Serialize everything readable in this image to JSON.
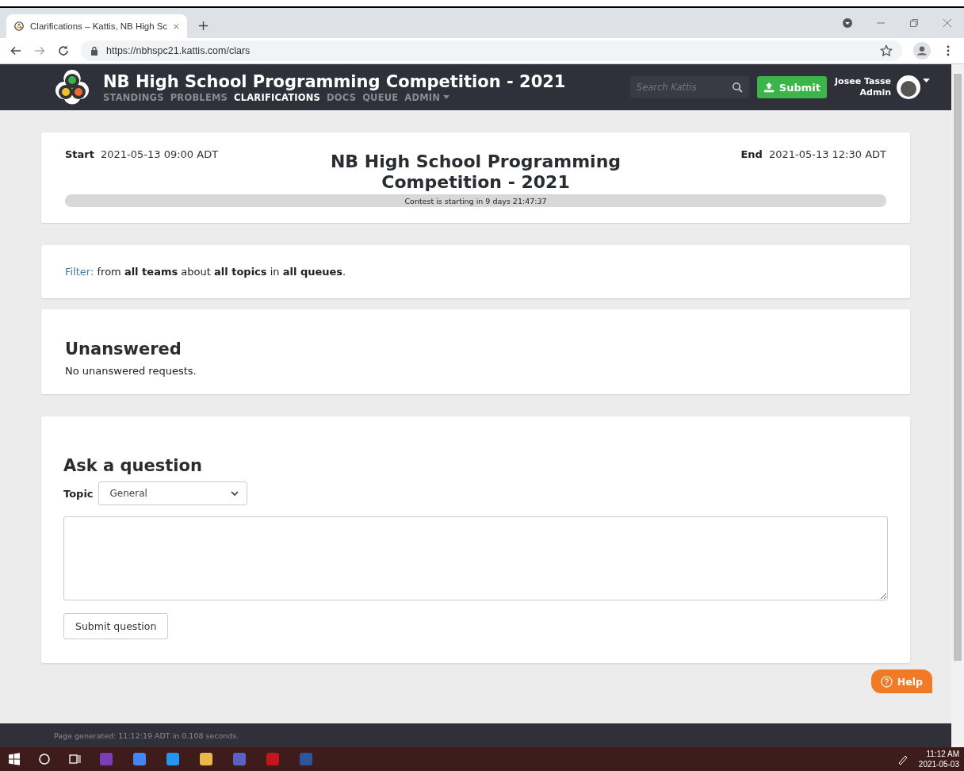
{
  "browser": {
    "tabs": [
      {
        "title": "Clarifications – Kattis, NB High Sc",
        "selected": true
      }
    ],
    "url": "https://nbhspc21.kattis.com/clars"
  },
  "site_header": {
    "title": "NB High School Programming Competition - 2021",
    "nav": [
      {
        "label": "STANDINGS",
        "selected": false
      },
      {
        "label": "PROBLEMS",
        "selected": false
      },
      {
        "label": "CLARIFICATIONS",
        "selected": true
      },
      {
        "label": "DOCS",
        "selected": false
      },
      {
        "label": "QUEUE",
        "selected": false
      },
      {
        "label": "ADMIN",
        "selected": false
      }
    ],
    "search": {
      "placeholder": "Search Kattis"
    },
    "submit_button": "Submit",
    "user": {
      "name": "Josee Tasse",
      "role": "Admin"
    }
  },
  "contest": {
    "start_label": "Start",
    "start": "2021-05-13 09:00 ADT",
    "title": "NB High School Programming Competition - 2021",
    "end_label": "End",
    "end": "2021-05-13 12:30 ADT",
    "progress": {
      "level": 0,
      "text": "Contest is starting in 9 days 21:47:37"
    }
  },
  "filter": {
    "link": "Filter:",
    "text": "from **all teams** about **all topics** in **all queues**."
  },
  "unanswered": {
    "heading": "Unanswered",
    "message": "No unanswered requests."
  },
  "ask": {
    "heading": "Ask a question",
    "topic_label": "Topic",
    "topic_value": "General",
    "submit": "Submit question"
  },
  "help_button": "Help",
  "footer": {
    "text": "Page generated: 11:12:19 ADT in 0.108 seconds."
  },
  "taskbar": {
    "time": "11:12 AM",
    "date": "2021-05-03"
  }
}
